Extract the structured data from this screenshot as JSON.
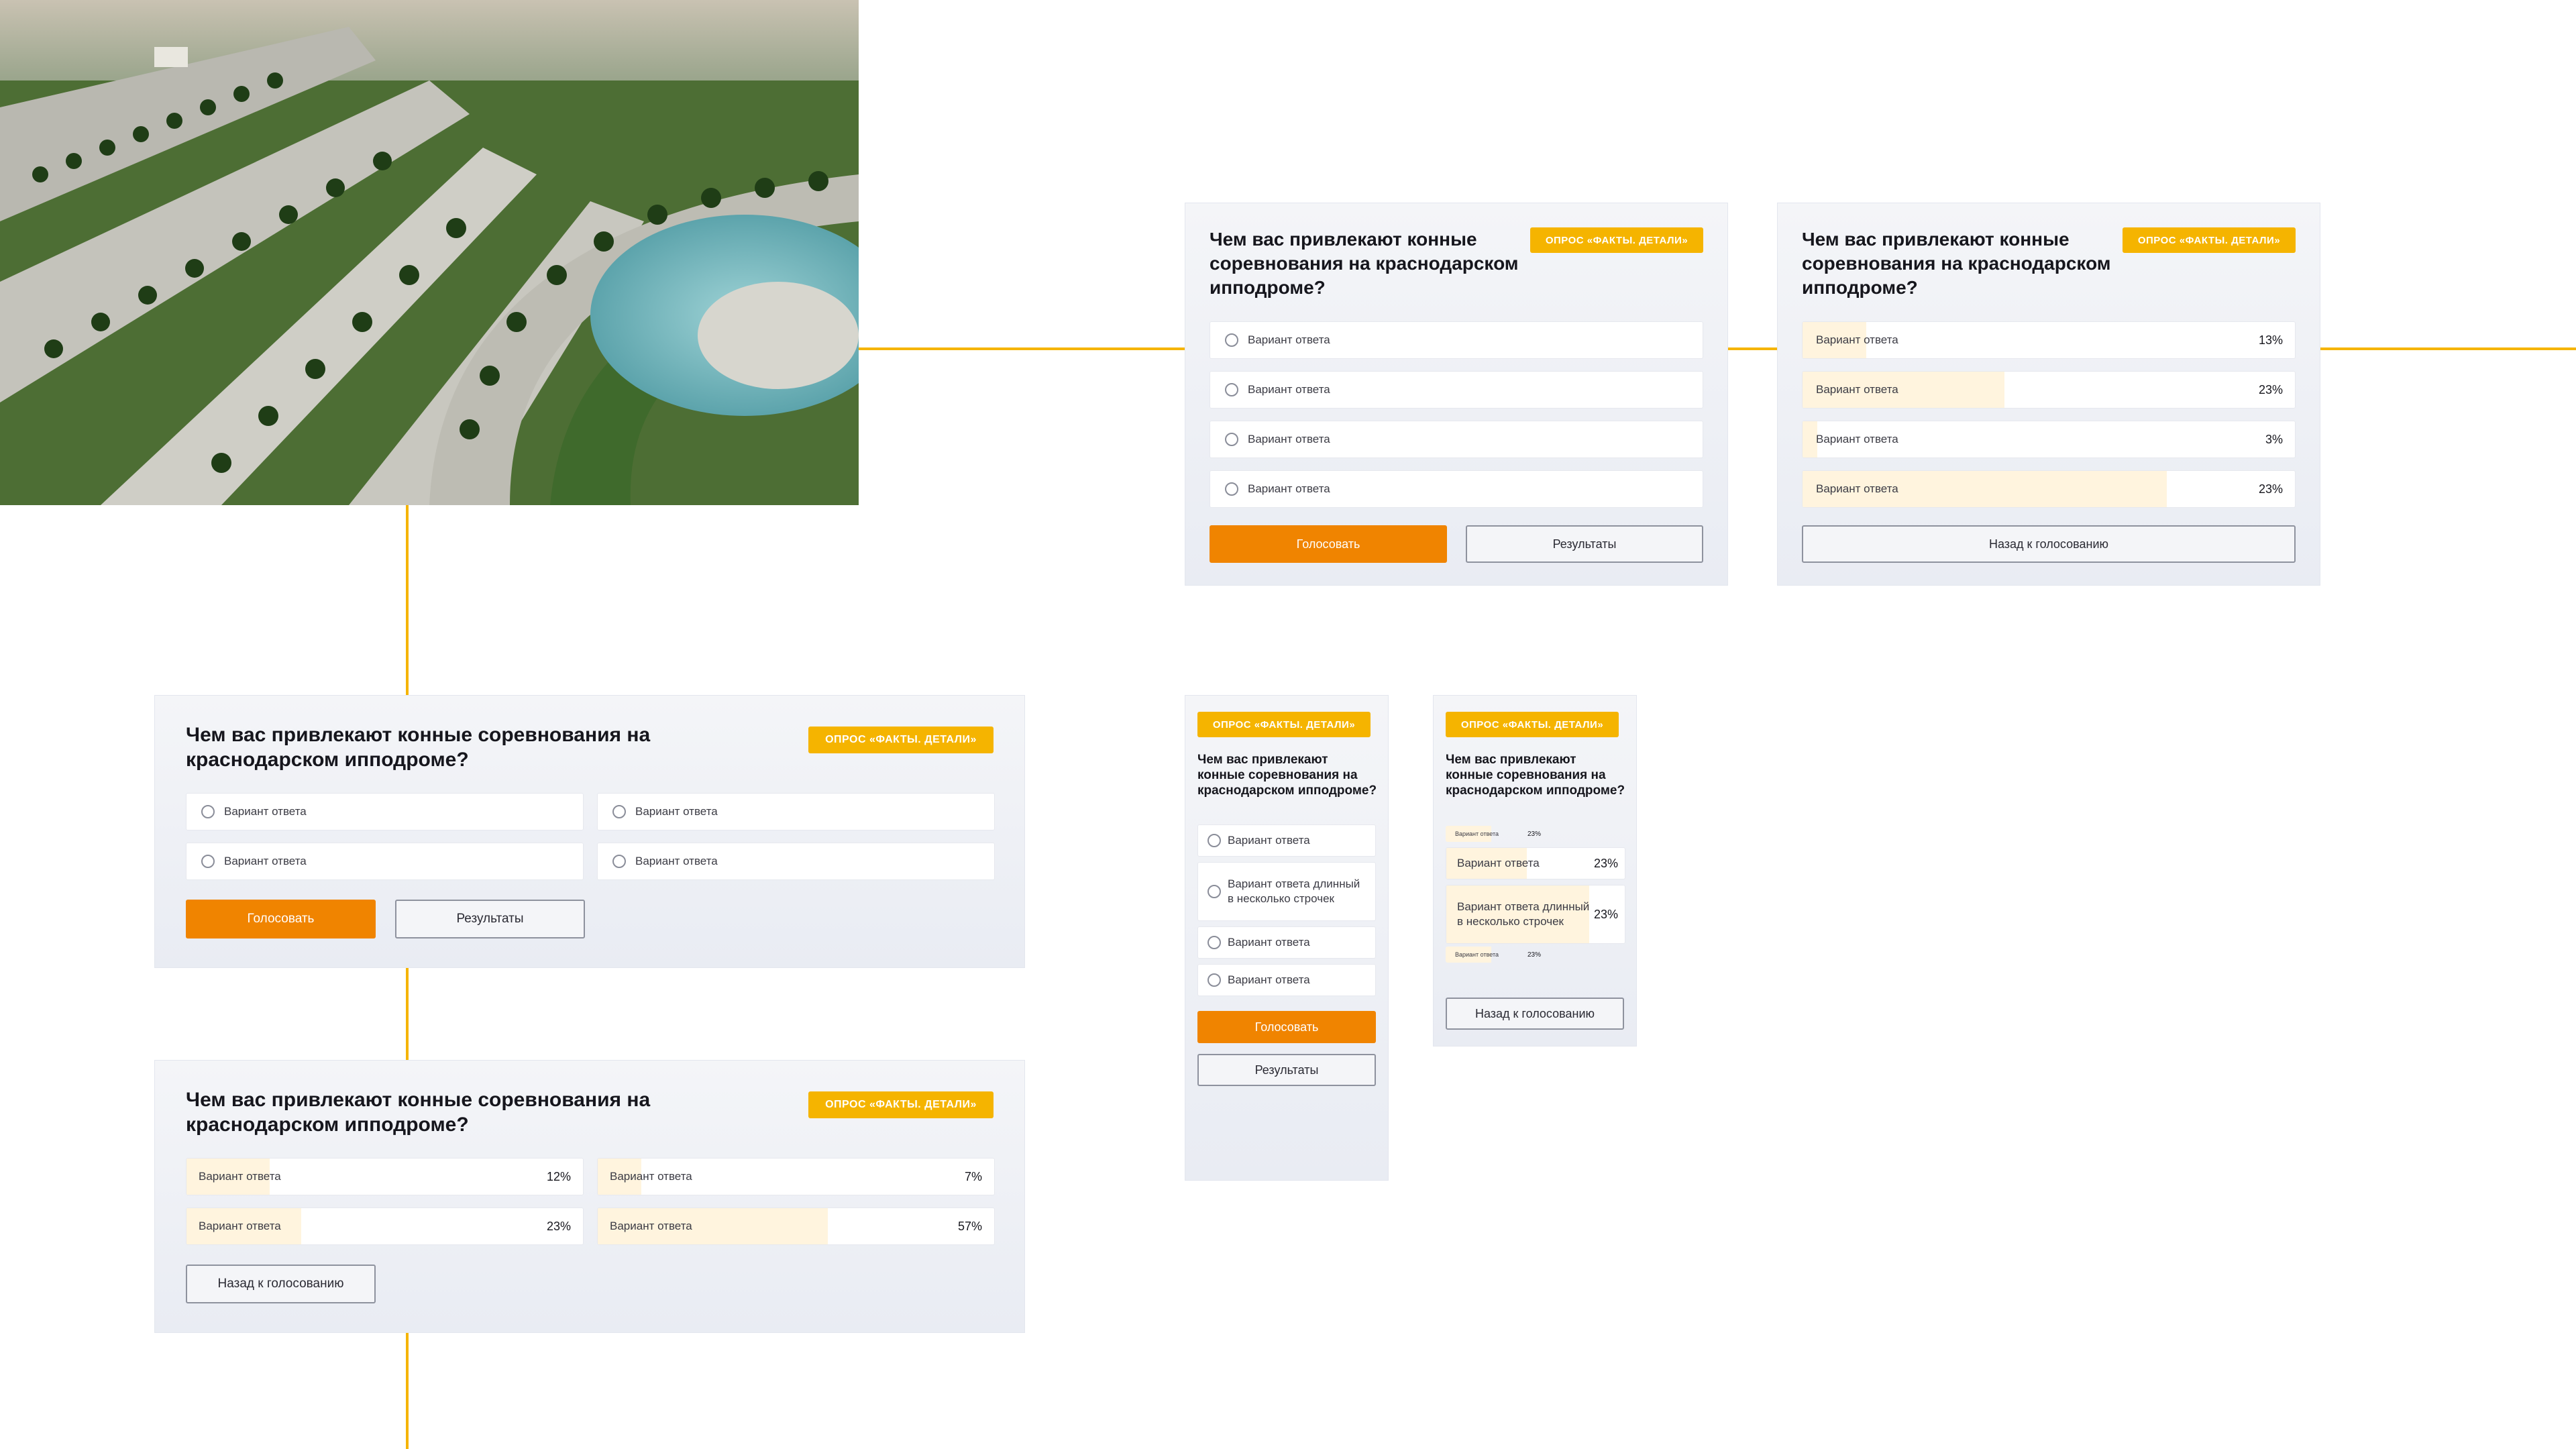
{
  "photo": {
    "alt_name": "park-photo"
  },
  "colors": {
    "accent": "#f5b400",
    "primary_button": "#f08400",
    "bar_fill": "#fff4de"
  },
  "poll": {
    "question": "Чем вас привлекают конные соревнования на краснодарском ипподроме?",
    "badge": "ОПРОС «ФАКТЫ. ДЕТАЛИ»",
    "vote_label": "Голосовать",
    "results_label": "Результаты",
    "back_label": "Назад к голосованию"
  },
  "desktop_vote": {
    "options": [
      "Вариант ответа",
      "Вариант ответа",
      "Вариант ответа",
      "Вариант ответа"
    ]
  },
  "desktop_results": {
    "rows": [
      {
        "label": "Вариант ответа",
        "percent": "13%",
        "fill": 0.13
      },
      {
        "label": "Вариант ответа",
        "percent": "23%",
        "fill": 0.41
      },
      {
        "label": "Вариант ответа",
        "percent": "3%",
        "fill": 0.03
      },
      {
        "label": "Вариант ответа",
        "percent": "23%",
        "fill": 0.74
      }
    ]
  },
  "wide_vote": {
    "options": [
      "Вариант ответа",
      "Вариант ответа",
      "Вариант ответа",
      "Вариант ответа"
    ]
  },
  "wide_results": {
    "rows": [
      {
        "label": "Вариант ответа",
        "percent": "12%",
        "fill": 0.21
      },
      {
        "label": "Вариант ответа",
        "percent": "7%",
        "fill": 0.11
      },
      {
        "label": "Вариант ответа",
        "percent": "23%",
        "fill": 0.29
      },
      {
        "label": "Вариант ответа",
        "percent": "57%",
        "fill": 0.58
      }
    ]
  },
  "mobile_vote": {
    "options": [
      "Вариант ответа",
      "Вариант ответа длинный в несколько строчек",
      "Вариант ответа",
      "Вариант ответа"
    ]
  },
  "mobile_results": {
    "rows": [
      {
        "label": "Вариант ответа",
        "percent": "23%",
        "fill": 0.45
      },
      {
        "label": "Вариант ответа",
        "percent": "23%",
        "fill": 0.45
      },
      {
        "label": "Вариант ответа длинный в несколько строчек",
        "percent": "23%",
        "fill": 0.8
      },
      {
        "label": "Вариант ответа",
        "percent": "23%",
        "fill": 0.45
      }
    ]
  }
}
